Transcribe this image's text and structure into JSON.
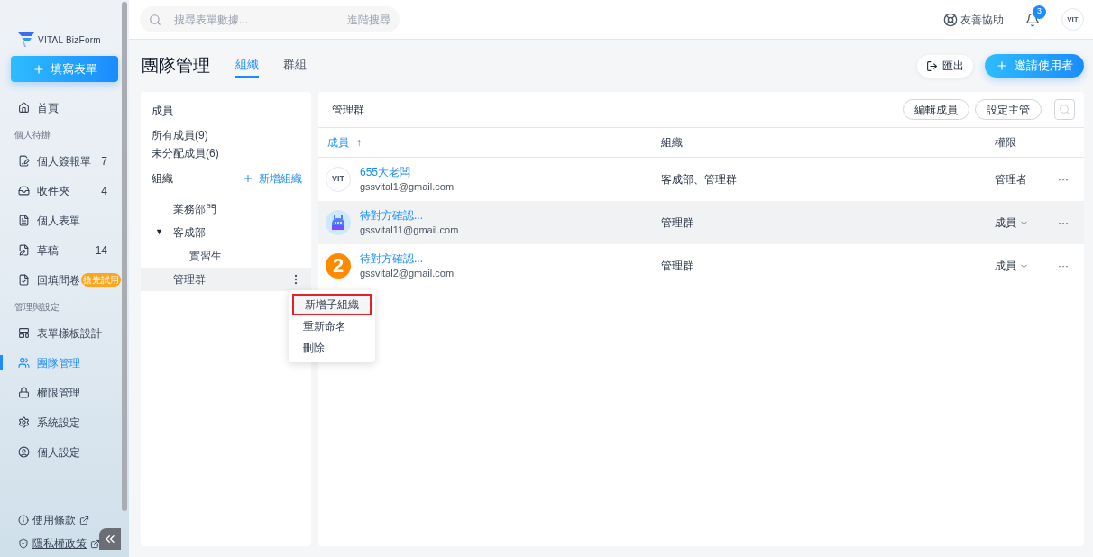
{
  "sidebar": {
    "logo": "VITAL BizForm",
    "primary_button": "填寫表單",
    "sections": [
      {
        "items": [
          {
            "label": "首頁",
            "selected": false
          }
        ]
      },
      {
        "title": "個人待辦",
        "items": [
          {
            "label": "個人簽報單",
            "count": "7",
            "selected": false
          },
          {
            "label": "收件夾",
            "count": "4",
            "selected": false
          },
          {
            "label": "個人表單",
            "selected": false
          },
          {
            "label": "草稿",
            "count": "14",
            "selected": false
          },
          {
            "label": "回填問卷",
            "badge": "搶先試用",
            "selected": false
          }
        ]
      },
      {
        "title": "管理與設定",
        "items": [
          {
            "label": "表單樣板設計",
            "selected": false
          },
          {
            "label": "團隊管理",
            "selected": true
          },
          {
            "label": "權限管理",
            "selected": false
          },
          {
            "label": "系統設定",
            "selected": false
          },
          {
            "label": "個人設定",
            "selected": false
          }
        ]
      }
    ],
    "links": [
      "使用條款",
      "隱私權政策"
    ]
  },
  "topbar": {
    "search": {
      "placeholder": "搜尋表單數據...",
      "advanced": "進階搜尋"
    },
    "help": "友善協助",
    "notifications": "3",
    "avatar_text": "VIT"
  },
  "page": {
    "title": "團隊管理",
    "tabs": [
      {
        "label": "組織",
        "selected": true
      },
      {
        "label": "群組",
        "selected": false
      }
    ],
    "export": "匯出",
    "invite": "邀請使用者"
  },
  "org_panel": {
    "members_title": "成員",
    "member_links": [
      "所有成員(9)",
      "未分配成員(6)"
    ],
    "org_title": "組織",
    "add_org": "新增組織",
    "tree": [
      {
        "label": "業務部門",
        "selected": false
      },
      {
        "label": "客成部",
        "toggle": "▼",
        "expanded": true,
        "selected": false,
        "children": [
          {
            "label": "實習生",
            "selected": false
          }
        ]
      },
      {
        "label": "管理群",
        "selected": true
      }
    ],
    "context_menu": [
      {
        "label": "新增子組織",
        "highlighted": true
      },
      {
        "label": "重新命名",
        "highlighted": false
      },
      {
        "label": "刪除",
        "highlighted": false
      }
    ]
  },
  "member_panel": {
    "title": "管理群",
    "buttons": [
      "編輯成員",
      "設定主管"
    ],
    "columns": [
      {
        "label": "成員",
        "sorted": true,
        "sort_arrow": "↑"
      },
      {
        "label": "組織",
        "sorted": false
      },
      {
        "label": "權限",
        "sorted": false
      }
    ],
    "rows": [
      {
        "avatar": {
          "kind": "logo",
          "text": "VIT"
        },
        "name": "655大老闆",
        "email": "gssvital1@gmail.com",
        "org": "客成部、管理群",
        "role": "管理者",
        "role_dropdown": false,
        "selected": false,
        "more": "···"
      },
      {
        "avatar": {
          "kind": "robot"
        },
        "name": "待對方確認...",
        "email": "gssvital11@gmail.com",
        "org": "管理群",
        "role": "成員",
        "role_dropdown": true,
        "selected": true,
        "more": "···"
      },
      {
        "avatar": {
          "kind": "number",
          "text": "2"
        },
        "name": "待對方確認...",
        "email": "gssvital2@gmail.com",
        "org": "管理群",
        "role": "成員",
        "role_dropdown": true,
        "selected": false,
        "more": "···"
      }
    ]
  }
}
